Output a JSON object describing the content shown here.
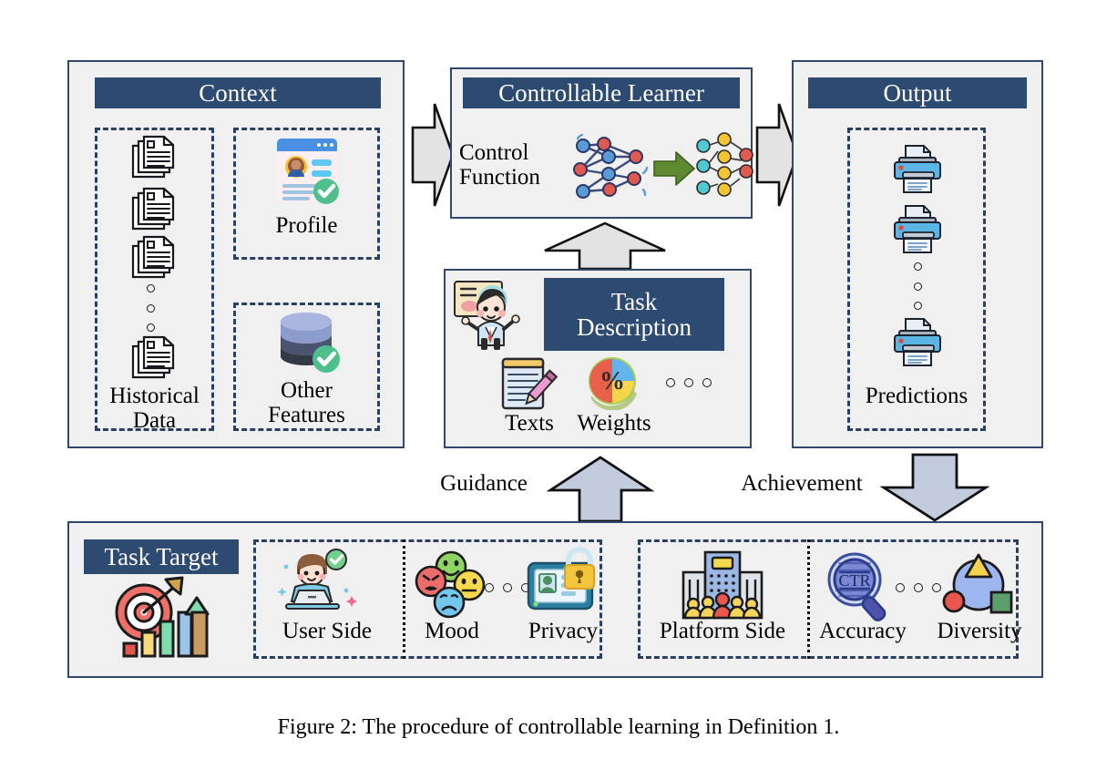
{
  "figure": {
    "caption": "Figure 2: The procedure of controllable learning in Definition 1."
  },
  "colors": {
    "header_navy": "#2d4a71",
    "panel_fill": "#f0f0f0",
    "panel_border": "#31486e",
    "dashed_border": "#2b3f63",
    "arrow_fill": "#dcdcdc",
    "arrow_fill_blue": "#c3ccdd",
    "green_arrow": "#5d8a2f"
  },
  "panels": {
    "context": {
      "title": "Context",
      "groups": [
        {
          "label": "Historical\nData",
          "icon": "documents-stack-icon"
        },
        {
          "label": "Profile",
          "icon": "profile-card-icon"
        },
        {
          "label": "Other\nFeatures",
          "icon": "database-check-icon"
        }
      ]
    },
    "controllable_learner": {
      "title": "Controllable Learner",
      "left_label": "Control\nFunction",
      "icons": [
        "neural-network-icon",
        "green-right-arrow-icon",
        "node-flow-icon"
      ]
    },
    "task_description": {
      "title": "Task\nDescription",
      "presenter_icon": "presenter-person-icon",
      "items": [
        {
          "label": "Texts",
          "icon": "notepad-pencil-icon"
        },
        {
          "label": "Weights",
          "icon": "percent-pie-icon"
        }
      ],
      "ellipsis": "..."
    },
    "output": {
      "title": "Output",
      "group_label": "Predictions",
      "icon": "printer-icon",
      "ellipsis": "..."
    },
    "task_target": {
      "title": "Task Target",
      "target_icon": "target-growth-icon",
      "user_side": {
        "label": "User Side",
        "icon": "user-laptop-check-icon",
        "aspects": [
          {
            "label": "Mood",
            "icon": "mood-faces-icon"
          },
          {
            "label": "Privacy",
            "icon": "id-card-lock-icon"
          }
        ],
        "ellipsis": "..."
      },
      "platform_side": {
        "label": "Platform Side",
        "icon": "building-people-icon",
        "aspects": [
          {
            "label": "Accuracy",
            "icon": "ctr-magnifier-icon"
          },
          {
            "label": "Diversity",
            "icon": "shapes-diversity-icon"
          }
        ],
        "ellipsis": "..."
      }
    }
  },
  "arrows": {
    "context_to_learner": "chevron-right-arrow",
    "learner_to_output": "chevron-right-arrow",
    "task_to_learner": "up-arrow",
    "guidance": {
      "label": "Guidance",
      "arrow": "up-arrow"
    },
    "achievement": {
      "label": "Achievement",
      "arrow": "down-arrow"
    }
  }
}
